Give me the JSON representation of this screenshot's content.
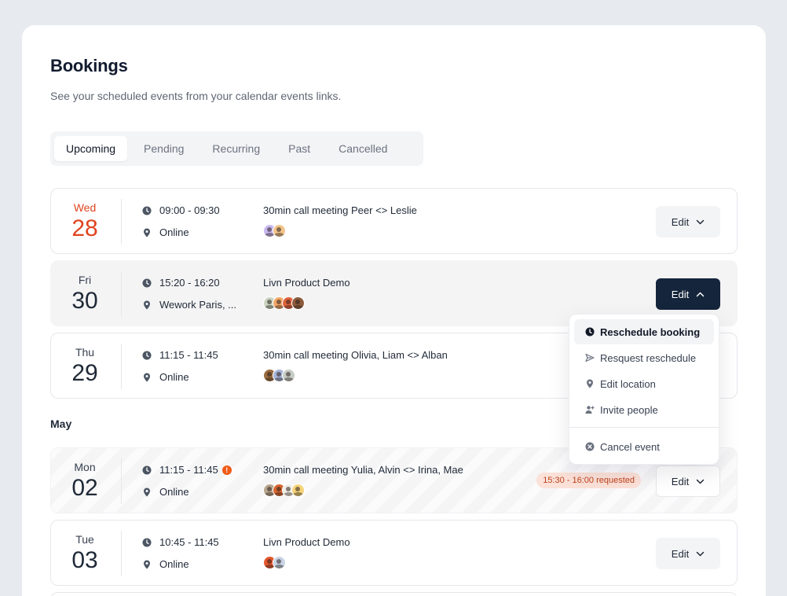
{
  "page": {
    "title": "Bookings",
    "subtitle": "See your scheduled events from your calendar events links."
  },
  "tabs": [
    {
      "label": "Upcoming",
      "active": true
    },
    {
      "label": "Pending"
    },
    {
      "label": "Recurring"
    },
    {
      "label": "Past"
    },
    {
      "label": "Cancelled"
    }
  ],
  "section_label": "May",
  "bookings": [
    {
      "dow": "Wed",
      "day": "28",
      "time": "09:00 - 09:30",
      "location": "Online",
      "title": "30min call meeting Peer <> Leslie",
      "edit": "Edit",
      "attendees": [
        "#c9b8f2",
        "#f2c48a"
      ]
    },
    {
      "dow": "Fri",
      "day": "30",
      "time": "15:20 - 16:20",
      "location": "Wework Paris, ...",
      "title": "Livn Product Demo",
      "edit": "Edit",
      "attendees": [
        "#cbd5c0",
        "#f2a766",
        "#e0623c",
        "#8c5a3c"
      ]
    },
    {
      "dow": "Thu",
      "day": "29",
      "time": "11:15 - 11:45",
      "location": "Online",
      "title": "30min call meeting Olivia, Liam <> Alban",
      "edit": "Edit",
      "attendees": [
        "#9a6b3f",
        "#a7b4d9",
        "#c6cdc5"
      ]
    },
    {
      "dow": "Mon",
      "day": "02",
      "time": "11:15 - 11:45",
      "location": "Online",
      "title": "30min call meeting Yulia, Alvin <> Irina, Mae",
      "edit": "Edit",
      "request": "15:30 - 16:00 requested",
      "attendees": [
        "#b7a58e",
        "#d4652f",
        "#f0ede6",
        "#f5d37a"
      ]
    },
    {
      "dow": "Tue",
      "day": "03",
      "time": "10:45 - 11:45",
      "location": "Online",
      "title": "Livn Product Demo",
      "edit": "Edit",
      "attendees": [
        "#e4572e",
        "#c9d4e6"
      ]
    }
  ],
  "menu": {
    "items": [
      {
        "label": "Reschedule booking",
        "icon": "clock-icon"
      },
      {
        "label": "Resquest reschedule",
        "icon": "send-icon"
      },
      {
        "label": "Edit location",
        "icon": "map-pin-icon"
      },
      {
        "label": "Invite people",
        "icon": "user-plus-icon"
      },
      {
        "label": "Cancel event",
        "icon": "x-circle-icon"
      }
    ]
  },
  "colors": {
    "accent_today": "#e0441f",
    "dark_button": "#15253b",
    "request_badge_bg": "#fbe1d8",
    "request_badge_text": "#c2411c",
    "warning": "#f05a16"
  }
}
